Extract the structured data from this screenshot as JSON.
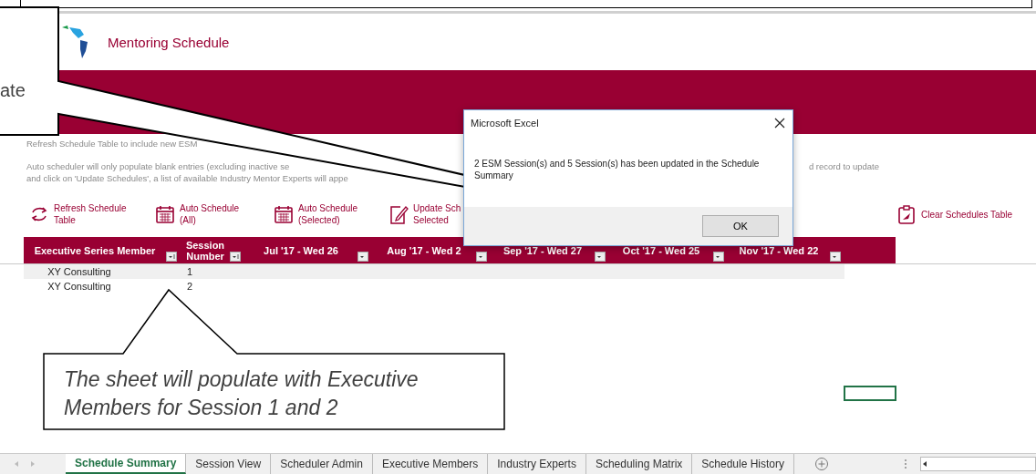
{
  "header": {
    "title": "Mentoring Schedule"
  },
  "callout_top": {
    "text": "ate"
  },
  "instructions": [
    {
      "text": "Refresh Schedule Table to include new ESM"
    },
    {
      "text": "Auto scheduler will only populate blank entries (excluding inactive se",
      "tail": "d record to update"
    },
    {
      "text": "and click on 'Update Schedules', a list of available Industry Mentor Experts will appe"
    }
  ],
  "toolbar": [
    {
      "kind": "refresh",
      "lines": [
        "Refresh Schedule",
        "Table"
      ]
    },
    {
      "kind": "calendar",
      "lines": [
        "Auto Schedule",
        "(All)"
      ]
    },
    {
      "kind": "calendar",
      "lines": [
        "Auto Schedule",
        "(Selected)"
      ]
    },
    {
      "kind": "edit",
      "lines": [
        "Update Sch",
        "Selected"
      ]
    },
    {
      "kind": "clipboard",
      "lines": [
        "Clear Schedules Table"
      ]
    }
  ],
  "table": {
    "columns": [
      {
        "label": "Executive Series Member",
        "sort": true
      },
      {
        "label": "Session Number",
        "sort": true
      },
      {
        "label": "Jul '17 - Wed 26",
        "sort": false
      },
      {
        "label": "Aug '17 - Wed 2",
        "sort": false
      },
      {
        "label": "Sep '17 - Wed 27",
        "sort": false
      },
      {
        "label": "Oct '17 - Wed 25",
        "sort": false
      },
      {
        "label": "Nov '17 - Wed 22",
        "sort": false
      }
    ],
    "rows": [
      {
        "member": "XY Consulting",
        "session": "1"
      },
      {
        "member": "XY Consulting",
        "session": "2"
      }
    ]
  },
  "callout_bottom": {
    "text": "The sheet will populate with Executive Members for Session 1 and 2"
  },
  "dialog": {
    "title": "Microsoft Excel",
    "message": "2 ESM Session(s) and 5 Session(s) has been updated in the Schedule Summary",
    "button": "OK"
  },
  "sheet_tabs": [
    {
      "label": "Schedule Summary",
      "selected": true
    },
    {
      "label": "Session View",
      "selected": false
    },
    {
      "label": "Scheduler Admin",
      "selected": false
    },
    {
      "label": "Executive Members",
      "selected": false
    },
    {
      "label": "Industry Experts",
      "selected": false
    },
    {
      "label": "Scheduling Matrix",
      "selected": false
    },
    {
      "label": "Schedule History",
      "selected": false
    }
  ]
}
